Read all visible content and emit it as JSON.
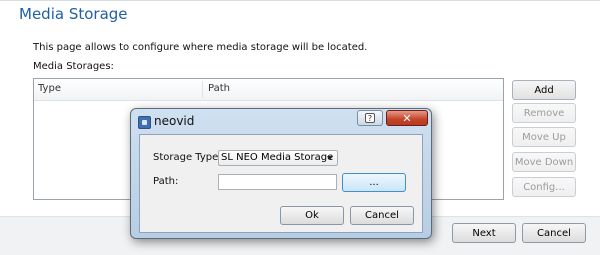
{
  "page": {
    "title": "Media Storage",
    "description": "This page allows to configure where media storage will be located.",
    "list_label": "Media Storages:"
  },
  "list": {
    "columns": [
      "Type",
      "Path"
    ],
    "rows": []
  },
  "side_buttons": {
    "add": "Add",
    "remove": "Remove",
    "move_up": "Move Up",
    "move_down": "Move Down",
    "config": "Config..."
  },
  "footer": {
    "next": "Next",
    "cancel": "Cancel"
  },
  "dialog": {
    "title": "neovid",
    "help_icon": "help-icon",
    "close_icon": "close-icon",
    "storage_type_label": "Storage Type:",
    "storage_type_value": "SL NEO Media Storage",
    "path_label": "Path:",
    "path_value": "",
    "browse_label": "...",
    "ok_label": "Ok",
    "cancel_label": "Cancel"
  },
  "colors": {
    "title_blue": "#1f5fa8",
    "close_red": "#c34329",
    "dialog_frame": "#b6cde3"
  }
}
